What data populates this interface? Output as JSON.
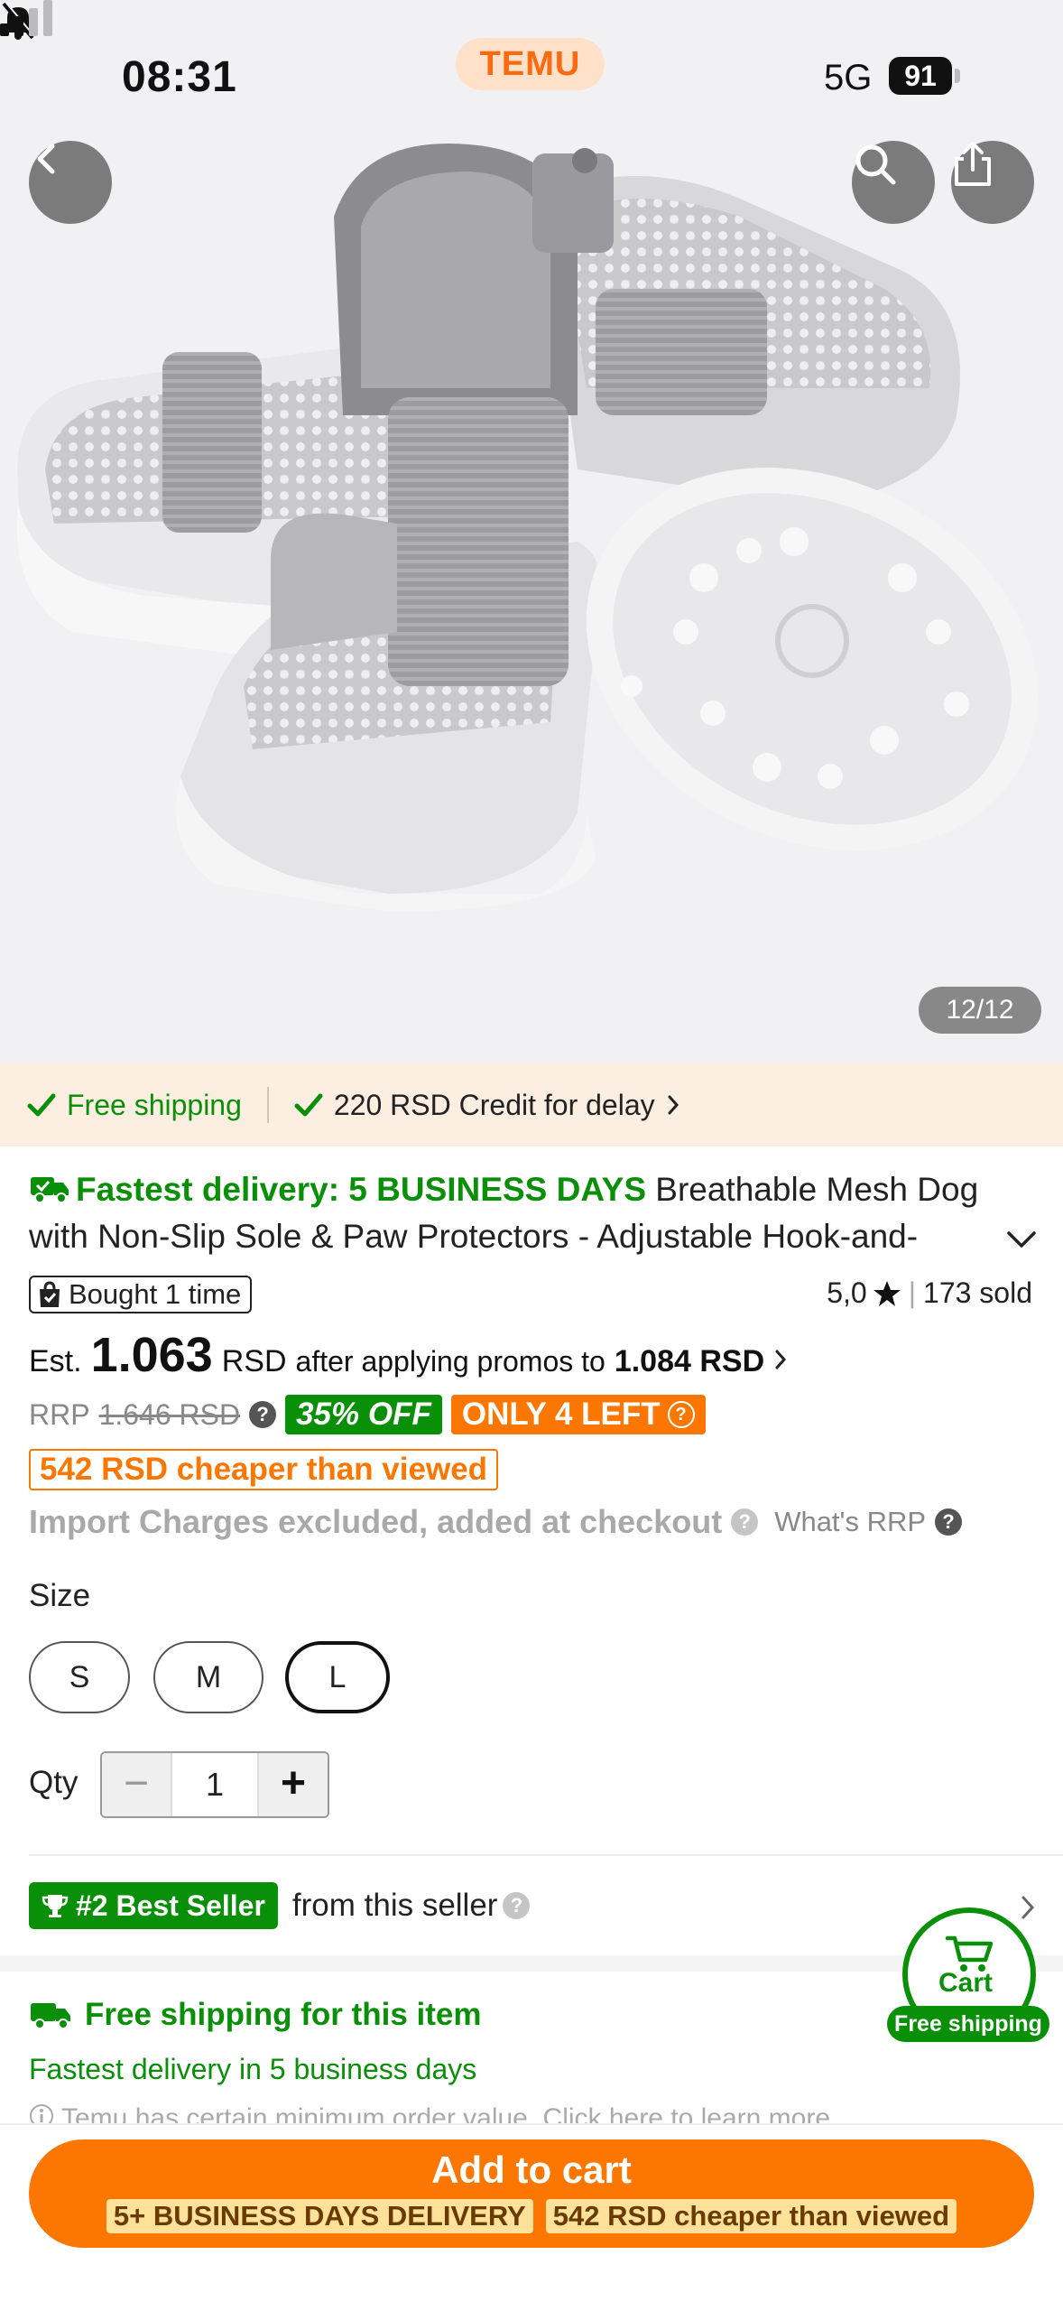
{
  "status_bar": {
    "time": "08:31",
    "network": "5G",
    "battery": "91"
  },
  "app": {
    "logo": "TEMU"
  },
  "gallery": {
    "counter": "12/12"
  },
  "shipping_banner": {
    "free_shipping": "Free shipping",
    "credit": "220 RSD Credit for delay"
  },
  "product": {
    "fast_delivery": "Fastest delivery: 5 BUSINESS DAYS",
    "title": "Breathable Mesh Dog with Non-Slip Sole & Paw Protectors - Adjustable Hook-and-",
    "bought": "Bought 1 time",
    "rating": "5,0",
    "sold": "173 sold",
    "est_label": "Est.",
    "est_price": "1.063",
    "currency": "RSD",
    "after_promo": "after applying promos to",
    "promo_price": "1.084 RSD",
    "rrp_label": "RRP",
    "rrp_value": "1.646 RSD",
    "discount": "35% OFF",
    "stock": "ONLY 4 LEFT",
    "cheaper": "542 RSD cheaper than viewed",
    "import_note": "Import Charges excluded, added at checkout",
    "whats_rrp": "What's RRP"
  },
  "size": {
    "label": "Size",
    "options": [
      "S",
      "M",
      "L"
    ],
    "selected": "L"
  },
  "qty": {
    "label": "Qty",
    "value": "1"
  },
  "best_seller": {
    "badge": "#2 Best Seller",
    "text": "from this seller"
  },
  "shipping_info": {
    "title": "Free shipping for this item",
    "delivery": "Fastest delivery in 5 business days",
    "note": "Temu has certain minimum order value. Click here to learn more"
  },
  "cart_float": {
    "label": "Cart",
    "badge": "Free shipping"
  },
  "cta": {
    "label": "Add to cart",
    "tag1": "5+ BUSINESS DAYS DELIVERY",
    "tag2": "542 RSD cheaper than viewed"
  },
  "colors": {
    "brand_orange": "#fb7701",
    "green": "#0a8f08"
  }
}
